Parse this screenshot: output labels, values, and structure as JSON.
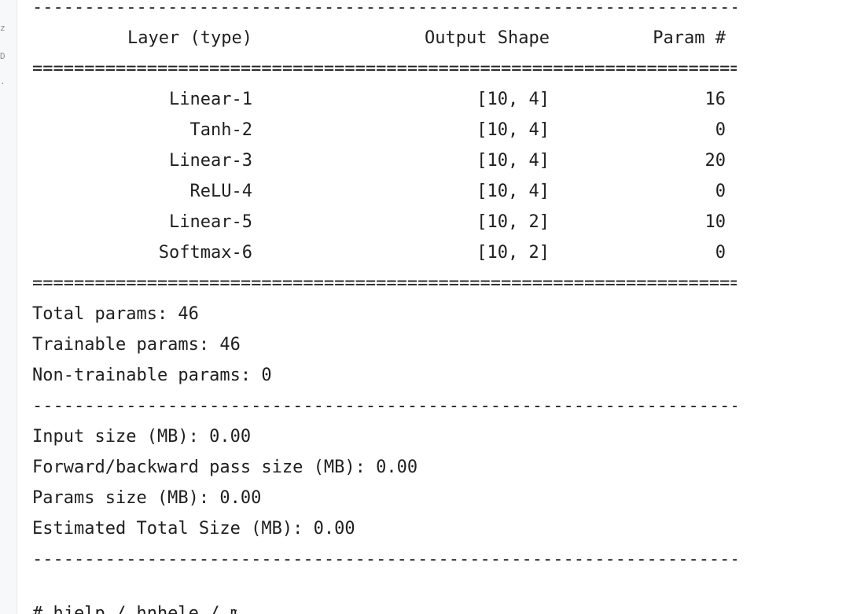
{
  "separators": {
    "dash": "-------------------------------------------------------------------------------------",
    "equals": "=====================================================================================",
    "cut_off_text": "# hjelp / hnhele / m..."
  },
  "table": {
    "headers": {
      "layer": "Layer (type)",
      "shape": "Output Shape",
      "param": "Param #"
    },
    "rows": [
      {
        "layer": "Linear-1",
        "shape": "[10, 4]",
        "param": "16"
      },
      {
        "layer": "Tanh-2",
        "shape": "[10, 4]",
        "param": "0"
      },
      {
        "layer": "Linear-3",
        "shape": "[10, 4]",
        "param": "20"
      },
      {
        "layer": "ReLU-4",
        "shape": "[10, 4]",
        "param": "0"
      },
      {
        "layer": "Linear-5",
        "shape": "[10, 2]",
        "param": "10"
      },
      {
        "layer": "Softmax-6",
        "shape": "[10, 2]",
        "param": "0"
      }
    ]
  },
  "totals": {
    "total": "Total params: 46",
    "trainable": "Trainable params: 46",
    "non_trainable": "Non-trainable params: 0"
  },
  "sizes": {
    "input": "Input size (MB): 0.00",
    "forward_backward": "Forward/backward pass size (MB): 0.00",
    "params": "Params size (MB): 0.00",
    "estimated_total": "Estimated Total Size (MB): 0.00"
  },
  "gutter": {
    "marks": [
      "z",
      "D",
      "."
    ]
  }
}
